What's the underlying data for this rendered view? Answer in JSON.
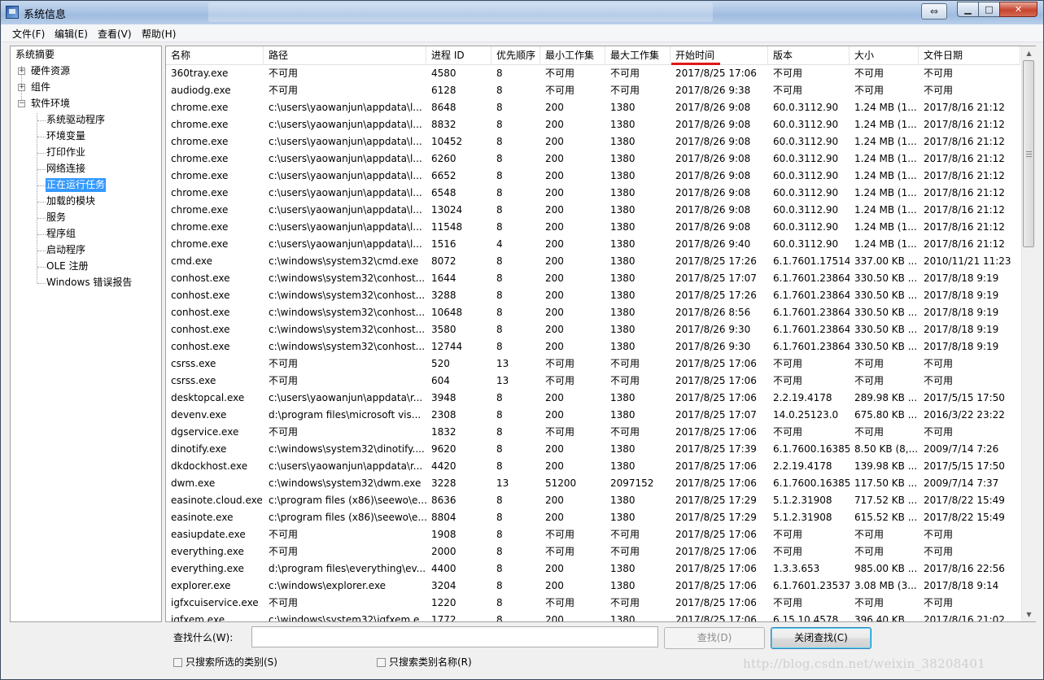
{
  "window": {
    "title": "系统信息",
    "blurred_title_text": "write.blog.csdn.net/mdeditor"
  },
  "menu": [
    "文件(F)",
    "编辑(E)",
    "查看(V)",
    "帮助(H)"
  ],
  "tree": {
    "root": "系统摘要",
    "level1": [
      "硬件资源",
      "组件",
      "软件环境"
    ],
    "software_children": [
      "系统驱动程序",
      "环境变量",
      "打印作业",
      "网络连接",
      "正在运行任务",
      "加载的模块",
      "服务",
      "程序组",
      "启动程序",
      "OLE 注册",
      "Windows 错误报告"
    ],
    "selected": "正在运行任务"
  },
  "columns": [
    "名称",
    "路径",
    "进程 ID",
    "优先顺序",
    "最小工作集",
    "最大工作集",
    "开始时间",
    "版本",
    "大小",
    "文件日期"
  ],
  "sorted_column": "开始时间",
  "rows": [
    [
      "360tray.exe",
      "不可用",
      "4580",
      "8",
      "不可用",
      "不可用",
      "2017/8/25 17:06",
      "不可用",
      "不可用",
      "不可用"
    ],
    [
      "audiodg.exe",
      "不可用",
      "6128",
      "8",
      "不可用",
      "不可用",
      "2017/8/26 9:38",
      "不可用",
      "不可用",
      "不可用"
    ],
    [
      "chrome.exe",
      "c:\\users\\yaowanjun\\appdata\\l...",
      "8648",
      "8",
      "200",
      "1380",
      "2017/8/26 9:08",
      "60.0.3112.90",
      "1.24 MB (1...",
      "2017/8/16 21:12"
    ],
    [
      "chrome.exe",
      "c:\\users\\yaowanjun\\appdata\\l...",
      "8832",
      "8",
      "200",
      "1380",
      "2017/8/26 9:08",
      "60.0.3112.90",
      "1.24 MB (1...",
      "2017/8/16 21:12"
    ],
    [
      "chrome.exe",
      "c:\\users\\yaowanjun\\appdata\\l...",
      "10452",
      "8",
      "200",
      "1380",
      "2017/8/26 9:08",
      "60.0.3112.90",
      "1.24 MB (1...",
      "2017/8/16 21:12"
    ],
    [
      "chrome.exe",
      "c:\\users\\yaowanjun\\appdata\\l...",
      "6260",
      "8",
      "200",
      "1380",
      "2017/8/26 9:08",
      "60.0.3112.90",
      "1.24 MB (1...",
      "2017/8/16 21:12"
    ],
    [
      "chrome.exe",
      "c:\\users\\yaowanjun\\appdata\\l...",
      "6652",
      "8",
      "200",
      "1380",
      "2017/8/26 9:08",
      "60.0.3112.90",
      "1.24 MB (1...",
      "2017/8/16 21:12"
    ],
    [
      "chrome.exe",
      "c:\\users\\yaowanjun\\appdata\\l...",
      "6548",
      "8",
      "200",
      "1380",
      "2017/8/26 9:08",
      "60.0.3112.90",
      "1.24 MB (1...",
      "2017/8/16 21:12"
    ],
    [
      "chrome.exe",
      "c:\\users\\yaowanjun\\appdata\\l...",
      "13024",
      "8",
      "200",
      "1380",
      "2017/8/26 9:08",
      "60.0.3112.90",
      "1.24 MB (1...",
      "2017/8/16 21:12"
    ],
    [
      "chrome.exe",
      "c:\\users\\yaowanjun\\appdata\\l...",
      "11548",
      "8",
      "200",
      "1380",
      "2017/8/26 9:08",
      "60.0.3112.90",
      "1.24 MB (1...",
      "2017/8/16 21:12"
    ],
    [
      "chrome.exe",
      "c:\\users\\yaowanjun\\appdata\\l...",
      "1516",
      "4",
      "200",
      "1380",
      "2017/8/26 9:40",
      "60.0.3112.90",
      "1.24 MB (1...",
      "2017/8/16 21:12"
    ],
    [
      "cmd.exe",
      "c:\\windows\\system32\\cmd.exe",
      "8072",
      "8",
      "200",
      "1380",
      "2017/8/25 17:26",
      "6.1.7601.17514",
      "337.00 KB ...",
      "2010/11/21 11:23"
    ],
    [
      "conhost.exe",
      "c:\\windows\\system32\\conhost...",
      "1644",
      "8",
      "200",
      "1380",
      "2017/8/25 17:07",
      "6.1.7601.23864",
      "330.50 KB ...",
      "2017/8/18 9:19"
    ],
    [
      "conhost.exe",
      "c:\\windows\\system32\\conhost...",
      "3288",
      "8",
      "200",
      "1380",
      "2017/8/25 17:26",
      "6.1.7601.23864",
      "330.50 KB ...",
      "2017/8/18 9:19"
    ],
    [
      "conhost.exe",
      "c:\\windows\\system32\\conhost...",
      "10648",
      "8",
      "200",
      "1380",
      "2017/8/26 8:56",
      "6.1.7601.23864",
      "330.50 KB ...",
      "2017/8/18 9:19"
    ],
    [
      "conhost.exe",
      "c:\\windows\\system32\\conhost...",
      "3580",
      "8",
      "200",
      "1380",
      "2017/8/26 9:30",
      "6.1.7601.23864",
      "330.50 KB ...",
      "2017/8/18 9:19"
    ],
    [
      "conhost.exe",
      "c:\\windows\\system32\\conhost...",
      "12744",
      "8",
      "200",
      "1380",
      "2017/8/26 9:30",
      "6.1.7601.23864",
      "330.50 KB ...",
      "2017/8/18 9:19"
    ],
    [
      "csrss.exe",
      "不可用",
      "520",
      "13",
      "不可用",
      "不可用",
      "2017/8/25 17:06",
      "不可用",
      "不可用",
      "不可用"
    ],
    [
      "csrss.exe",
      "不可用",
      "604",
      "13",
      "不可用",
      "不可用",
      "2017/8/25 17:06",
      "不可用",
      "不可用",
      "不可用"
    ],
    [
      "desktopcal.exe",
      "c:\\users\\yaowanjun\\appdata\\r...",
      "3948",
      "8",
      "200",
      "1380",
      "2017/8/25 17:06",
      "2.2.19.4178",
      "289.98 KB ...",
      "2017/5/15 17:50"
    ],
    [
      "devenv.exe",
      "d:\\program files\\microsoft vis...",
      "2308",
      "8",
      "200",
      "1380",
      "2017/8/25 17:07",
      "14.0.25123.0",
      "675.80 KB ...",
      "2016/3/22 23:22"
    ],
    [
      "dgservice.exe",
      "不可用",
      "1832",
      "8",
      "不可用",
      "不可用",
      "2017/8/25 17:06",
      "不可用",
      "不可用",
      "不可用"
    ],
    [
      "dinotify.exe",
      "c:\\windows\\system32\\dinotify....",
      "9620",
      "8",
      "200",
      "1380",
      "2017/8/25 17:39",
      "6.1.7600.16385",
      "8.50 KB (8,...",
      "2009/7/14 7:26"
    ],
    [
      "dkdockhost.exe",
      "c:\\users\\yaowanjun\\appdata\\r...",
      "4420",
      "8",
      "200",
      "1380",
      "2017/8/25 17:06",
      "2.2.19.4178",
      "139.98 KB ...",
      "2017/5/15 17:50"
    ],
    [
      "dwm.exe",
      "c:\\windows\\system32\\dwm.exe",
      "3228",
      "13",
      "51200",
      "2097152",
      "2017/8/25 17:06",
      "6.1.7600.16385",
      "117.50 KB ...",
      "2009/7/14 7:37"
    ],
    [
      "easinote.cloud.exe",
      "c:\\program files (x86)\\seewo\\e...",
      "8636",
      "8",
      "200",
      "1380",
      "2017/8/25 17:29",
      "5.1.2.31908",
      "717.52 KB ...",
      "2017/8/22 15:49"
    ],
    [
      "easinote.exe",
      "c:\\program files (x86)\\seewo\\e...",
      "8804",
      "8",
      "200",
      "1380",
      "2017/8/25 17:29",
      "5.1.2.31908",
      "615.52 KB ...",
      "2017/8/22 15:49"
    ],
    [
      "easiupdate.exe",
      "不可用",
      "1908",
      "8",
      "不可用",
      "不可用",
      "2017/8/25 17:06",
      "不可用",
      "不可用",
      "不可用"
    ],
    [
      "everything.exe",
      "不可用",
      "2000",
      "8",
      "不可用",
      "不可用",
      "2017/8/25 17:06",
      "不可用",
      "不可用",
      "不可用"
    ],
    [
      "everything.exe",
      "d:\\program files\\everything\\ev...",
      "4400",
      "8",
      "200",
      "1380",
      "2017/8/25 17:06",
      "1.3.3.653",
      "985.00 KB ...",
      "2017/8/16 22:56"
    ],
    [
      "explorer.exe",
      "c:\\windows\\explorer.exe",
      "3204",
      "8",
      "200",
      "1380",
      "2017/8/25 17:06",
      "6.1.7601.23537",
      "3.08 MB (3...",
      "2017/8/18 9:14"
    ],
    [
      "igfxcuiservice.exe",
      "不可用",
      "1220",
      "8",
      "不可用",
      "不可用",
      "2017/8/25 17:06",
      "不可用",
      "不可用",
      "不可用"
    ],
    [
      "igfxem.exe",
      "c:\\windows\\system32\\igfxem.e...",
      "1772",
      "8",
      "200",
      "1380",
      "2017/8/25 17:06",
      "6.15.10.4578",
      "396.40 KB ...",
      "2017/8/16 21:02"
    ]
  ],
  "search": {
    "label": "查找什么(W):",
    "value": "",
    "find_button": "查找(D)",
    "close_button": "关闭查找(C)",
    "checkbox_selected_category": "只搜索所选的类别(S)",
    "checkbox_category_names": "只搜索类别名称(R)"
  },
  "watermark": "http://blog.csdn.net/weixin_38208401"
}
